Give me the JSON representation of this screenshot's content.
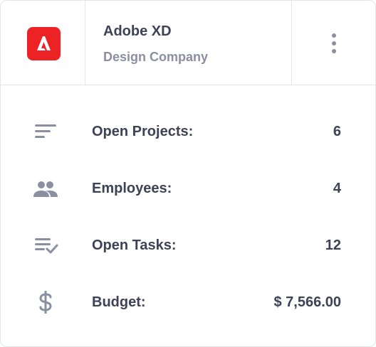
{
  "company": {
    "name": "Adobe XD",
    "type": "Design Company",
    "logo_icon": "adobe-logo-icon",
    "logo_color": "#ed2224"
  },
  "menu": {
    "icon": "more-vertical-icon"
  },
  "stats": [
    {
      "icon": "sort-lines-icon",
      "label": "Open Projects:",
      "value": "6"
    },
    {
      "icon": "people-icon",
      "label": "Employees:",
      "value": "4"
    },
    {
      "icon": "list-check-icon",
      "label": "Open Tasks:",
      "value": "12"
    },
    {
      "icon": "dollar-icon",
      "label": "Budget:",
      "value": "$ 7,566.00"
    }
  ],
  "colors": {
    "text_primary": "#3d4256",
    "text_secondary": "#8b8fa2",
    "icon": "#8b8fa2",
    "border": "#e2e5ec"
  }
}
